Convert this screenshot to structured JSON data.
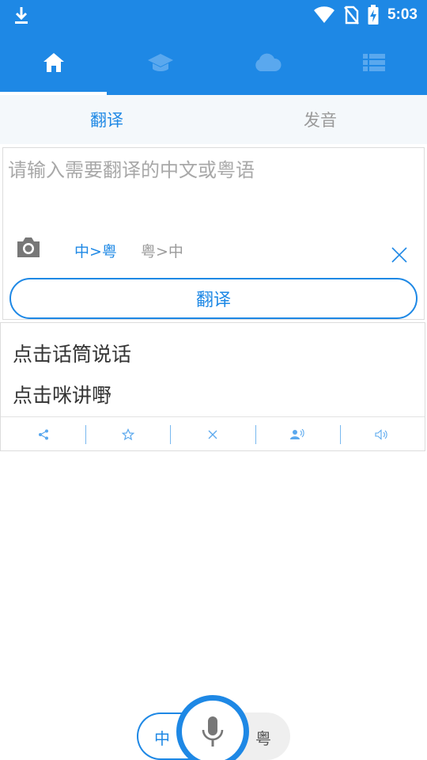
{
  "status_bar": {
    "time": "5:03",
    "icons": [
      "download-icon",
      "wifi-icon",
      "no-sim-icon",
      "battery-charging-icon"
    ]
  },
  "top_nav": {
    "tabs": [
      {
        "icon": "home-icon",
        "active": true
      },
      {
        "icon": "graduation-cap-icon",
        "active": false
      },
      {
        "icon": "cloud-icon",
        "active": false
      },
      {
        "icon": "list-icon",
        "active": false
      }
    ]
  },
  "sub_tabs": {
    "translate": "翻译",
    "pronounce": "发音"
  },
  "input": {
    "placeholder": "请输入需要翻译的中文或粤语",
    "direction_zh_to_yue": "中>粤",
    "direction_yue_to_zh": "粤>中",
    "translate_button": "翻译"
  },
  "result": {
    "line1": "点击话筒说话",
    "line2": "点击咪讲嘢",
    "actions": [
      "share-icon",
      "star-icon",
      "close-icon",
      "speaker-person-icon",
      "volume-icon"
    ]
  },
  "bottom": {
    "lang_left": "中",
    "lang_right": "粤"
  },
  "colors": {
    "primary": "#1e88e5",
    "muted_text": "#9a9a9a"
  }
}
